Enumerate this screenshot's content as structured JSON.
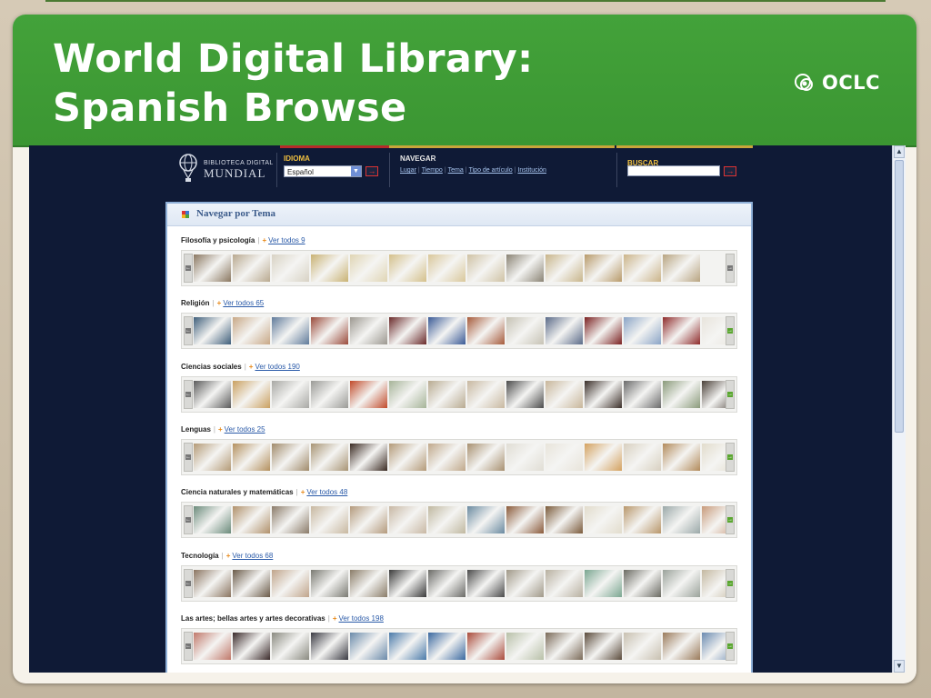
{
  "slide": {
    "title_line1": "World Digital Library:",
    "title_line2": "Spanish Browse",
    "logo_text": "OCLC",
    "accent": "#43a23a"
  },
  "site": {
    "logo_line1": "BIBLIOTECA DIGITAL",
    "logo_line2": "MUNDIAL",
    "idioma_label": "IDIOMA",
    "language_value": "Español",
    "navegar_label": "NAVEGAR",
    "nav_links": [
      "Lugar",
      "Tiempo",
      "Tema",
      "Tipo de artículo",
      "Institución"
    ],
    "buscar_label": "BUSCAR",
    "go_symbol": "→"
  },
  "panel": {
    "title": "Navegar por Tema",
    "categories": [
      {
        "name": "Filosofía y psicología",
        "link": "Ver todos 9",
        "right_active": false,
        "colors": [
          "#8a7760",
          "#b9a98f",
          "#d8d2c4",
          "#c9b273",
          "#e0d5b4",
          "#d4c08a",
          "#d9c79a",
          "#cfc2a4",
          "#8a8374",
          "#c8b58a",
          "#b89a6a",
          "#cbb489",
          "#b8a480"
        ]
      },
      {
        "name": "Religión",
        "link": "Ver todos 65",
        "right_active": true,
        "colors": [
          "#3e5e7a",
          "#c8a886",
          "#5f7a9a",
          "#9a4a3a",
          "#9c9890",
          "#6a2a2a",
          "#3a5a96",
          "#a65a3a",
          "#c6c2b4",
          "#5a6a88",
          "#7a2020",
          "#8aa4c6",
          "#8e2a2a",
          "#e8e4dc"
        ]
      },
      {
        "name": "Ciencias sociales",
        "link": "Ver todos 190",
        "right_active": true,
        "colors": [
          "#5a5a5a",
          "#caa060",
          "#a8a8a4",
          "#9a9a96",
          "#c14a2a",
          "#a6b498",
          "#b8aa90",
          "#c8b8a0",
          "#4a4a4a",
          "#c8b69a",
          "#3a2e28",
          "#6a6a6a",
          "#8a9a7a",
          "#4a4038"
        ]
      },
      {
        "name": "Lenguas",
        "link": "Ver todos 25",
        "right_active": true,
        "colors": [
          "#b49a76",
          "#b4905e",
          "#a08a6a",
          "#a89474",
          "#3a2a22",
          "#b49a78",
          "#c0a88a",
          "#a89070",
          "#e0ddd4",
          "#e8e4da",
          "#d4a260",
          "#d8d0c0",
          "#b28a5a",
          "#e2dccc",
          "#c8b8a0"
        ]
      },
      {
        "name": "Ciencia naturales y matemáticas",
        "link": "Ver todos 48",
        "right_active": true,
        "colors": [
          "#6a8a7a",
          "#b0906a",
          "#8a7a68",
          "#c8b8a0",
          "#b49a7c",
          "#c8b8a4",
          "#c0b8a0",
          "#6a8aa0",
          "#8a5a3a",
          "#7a5a3a",
          "#e2dccc",
          "#b8966a",
          "#9aa8a8",
          "#c89a7a"
        ]
      },
      {
        "name": "Tecnología",
        "link": "Ver todos 68",
        "right_active": true,
        "colors": [
          "#8a7460",
          "#6a5a48",
          "#c0a48a",
          "#7a7a72",
          "#8a7c68",
          "#3a3a3a",
          "#6a6a66",
          "#4a4a4a",
          "#a09888",
          "#b8b0a0",
          "#7aa690",
          "#6a6a62",
          "#9aa29a",
          "#c4b8a0"
        ]
      },
      {
        "name": "Las artes; bellas artes y artes decorativas",
        "link": "Ver todos 198",
        "right_active": true,
        "colors": [
          "#c0786a",
          "#3a2a2a",
          "#8a8a80",
          "#3a3a42",
          "#6a8aaa",
          "#4a7aaa",
          "#3a68a0",
          "#aa4a3a",
          "#b8c0a8",
          "#7a6a58",
          "#5a4a3a",
          "#c8c0b0",
          "#9a7a5a",
          "#6a8ab0"
        ]
      }
    ]
  }
}
